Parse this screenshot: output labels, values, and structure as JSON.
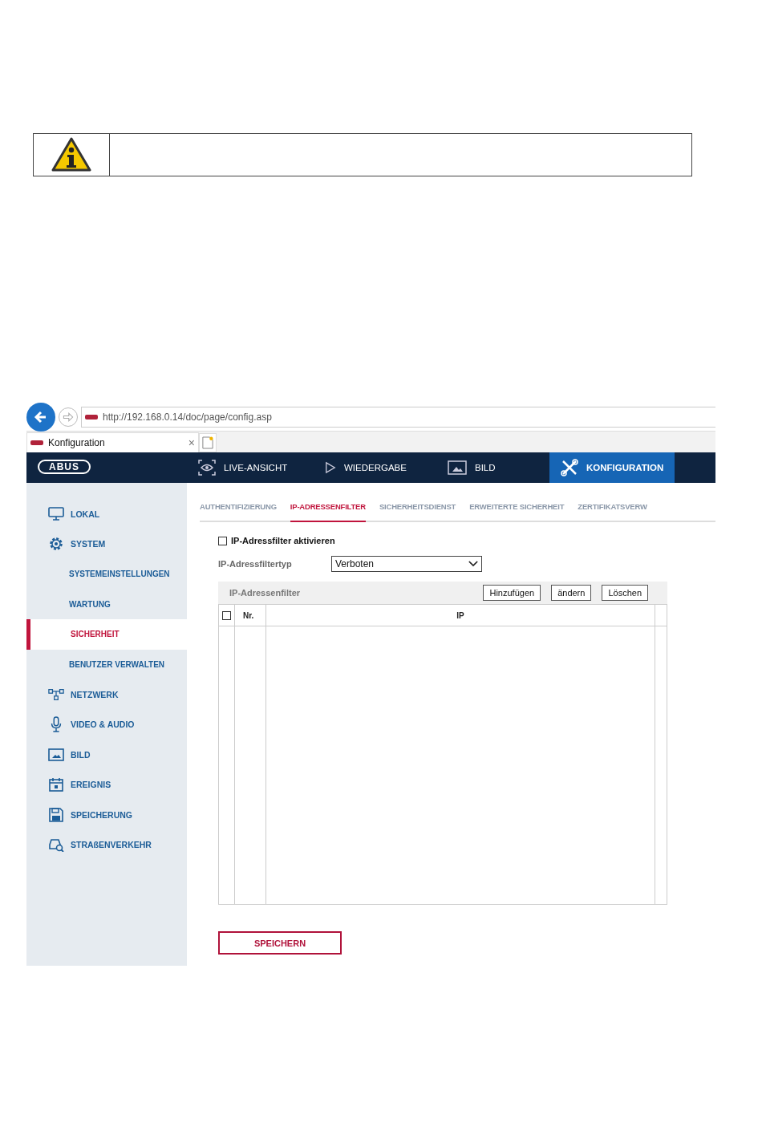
{
  "browser": {
    "url": "http://192.168.0.14/doc/page/config.asp",
    "tab": {
      "title": "Konfiguration",
      "close": "×"
    }
  },
  "nav": {
    "logo": "ABUS",
    "items": [
      {
        "label": "LIVE-ANSICHT",
        "kind": "live",
        "selected": false
      },
      {
        "label": "WIEDERGABE",
        "kind": "play",
        "selected": false
      },
      {
        "label": "BILD",
        "kind": "image",
        "selected": false
      },
      {
        "label": "KONFIGURATION",
        "kind": "tools",
        "selected": true
      }
    ]
  },
  "sidebar": {
    "items": [
      {
        "label": "LOKAL",
        "kind": "monitor",
        "selected": false
      },
      {
        "label": "SYSTEM",
        "kind": "gear",
        "selected": false,
        "expanded": true,
        "children": [
          {
            "label": "SYSTEMEINSTELLUNGEN",
            "selected": false
          },
          {
            "label": "WARTUNG",
            "selected": false
          },
          {
            "label": "SICHERHEIT",
            "selected": true
          },
          {
            "label": "BENUTZER VERWALTEN",
            "selected": false
          }
        ]
      },
      {
        "label": "NETZWERK",
        "kind": "network",
        "selected": false
      },
      {
        "label": "VIDEO & AUDIO",
        "kind": "mic",
        "selected": false
      },
      {
        "label": "BILD",
        "kind": "image",
        "selected": false
      },
      {
        "label": "EREIGNIS",
        "kind": "calendar",
        "selected": false
      },
      {
        "label": "SPEICHERUNG",
        "kind": "disk",
        "selected": false
      },
      {
        "label": "STRAßENVERKEHR",
        "kind": "car",
        "selected": false
      }
    ]
  },
  "tabs": [
    {
      "label": "AUTHENTIFIZIERUNG",
      "selected": false
    },
    {
      "label": "IP-ADRESSENFILTER",
      "selected": true
    },
    {
      "label": "SICHERHEITSDIENST",
      "selected": false
    },
    {
      "label": "ERWEITERTE SICHERHEIT",
      "selected": false
    },
    {
      "label": "ZERTIFIKATSVERW",
      "selected": false
    }
  ],
  "form": {
    "enable": {
      "label": "IP-Adressfilter aktivieren",
      "checked": false
    },
    "type": {
      "label": "IP-Adressfiltertyp",
      "value": "Verboten"
    }
  },
  "table": {
    "title": "IP-Adressenfilter",
    "buttons": [
      "Hinzufügen",
      "ändern",
      "Löschen"
    ],
    "select_all": {
      "checked": false
    },
    "columns": [
      "Nr.",
      "IP"
    ]
  },
  "save_button": "SPEICHERN"
}
